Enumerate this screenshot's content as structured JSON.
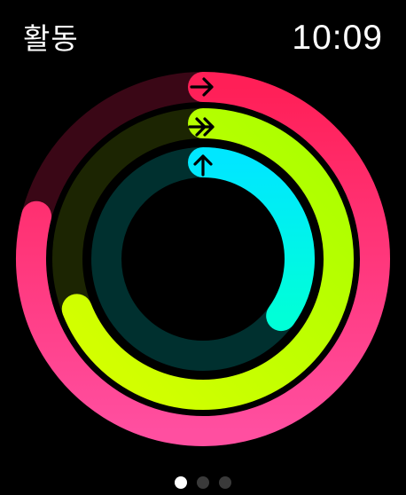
{
  "header": {
    "app_title": "활동",
    "time": "10:09"
  },
  "rings": [
    {
      "name": "move",
      "progress": 0.79,
      "color_start": "#ff1f57",
      "color_end": "#ff4fa0",
      "track_color": "#3a0716",
      "icon": "right-arrow-icon"
    },
    {
      "name": "exercise",
      "progress": 0.69,
      "color_start": "#a8ff00",
      "color_end": "#d8ff00",
      "track_color": "#1c2502",
      "icon": "double-right-arrow-icon"
    },
    {
      "name": "stand",
      "progress": 0.35,
      "color_start": "#00e7ff",
      "color_end": "#00ffd8",
      "track_color": "#00302f",
      "icon": "up-arrow-icon"
    }
  ],
  "pagination": {
    "count": 3,
    "active_index": 0
  }
}
